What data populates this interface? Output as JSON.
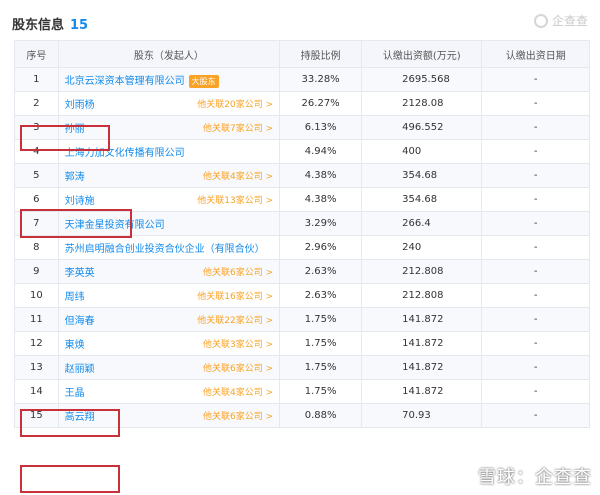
{
  "header": {
    "title": "股东信息",
    "count": "15",
    "logo_text": "企查查"
  },
  "table": {
    "columns": [
      "序号",
      "股东（发起人）",
      "持股比例",
      "认缴出资额(万元)",
      "认缴出资日期"
    ],
    "rows": [
      {
        "idx": "1",
        "name": "北京云深资本管理有限公司",
        "badge": "大股东",
        "rel": "",
        "ratio": "33.28%",
        "amount": "2695.568",
        "date": "-"
      },
      {
        "idx": "2",
        "name": "刘雨杨",
        "badge": "",
        "rel": "他关联20家公司 >",
        "ratio": "26.27%",
        "amount": "2128.08",
        "date": "-"
      },
      {
        "idx": "3",
        "name": "孙丽",
        "badge": "",
        "rel": "他关联7家公司 >",
        "ratio": "6.13%",
        "amount": "496.552",
        "date": "-"
      },
      {
        "idx": "4",
        "name": "上海力加文化传播有限公司",
        "badge": "",
        "rel": "",
        "ratio": "4.94%",
        "amount": "400",
        "date": "-"
      },
      {
        "idx": "5",
        "name": "郭涛",
        "badge": "",
        "rel": "他关联4家公司 >",
        "ratio": "4.38%",
        "amount": "354.68",
        "date": "-"
      },
      {
        "idx": "6",
        "name": "刘诗施",
        "badge": "",
        "rel": "他关联13家公司 >",
        "ratio": "4.38%",
        "amount": "354.68",
        "date": "-"
      },
      {
        "idx": "7",
        "name": "天津金星投资有限公司",
        "badge": "",
        "rel": "",
        "ratio": "3.29%",
        "amount": "266.4",
        "date": "-"
      },
      {
        "idx": "8",
        "name": "苏州启明融合创业投资合伙企业（有限合伙）",
        "badge": "",
        "rel": "",
        "ratio": "2.96%",
        "amount": "240",
        "date": "-"
      },
      {
        "idx": "9",
        "name": "李英英",
        "badge": "",
        "rel": "他关联6家公司 >",
        "ratio": "2.63%",
        "amount": "212.808",
        "date": "-"
      },
      {
        "idx": "10",
        "name": "周纬",
        "badge": "",
        "rel": "他关联16家公司 >",
        "ratio": "2.63%",
        "amount": "212.808",
        "date": "-"
      },
      {
        "idx": "11",
        "name": "但海春",
        "badge": "",
        "rel": "他关联22家公司 >",
        "ratio": "1.75%",
        "amount": "141.872",
        "date": "-"
      },
      {
        "idx": "12",
        "name": "東焕",
        "badge": "",
        "rel": "他关联3家公司 >",
        "ratio": "1.75%",
        "amount": "141.872",
        "date": "-"
      },
      {
        "idx": "13",
        "name": "赵丽颖",
        "badge": "",
        "rel": "他关联6家公司 >",
        "ratio": "1.75%",
        "amount": "141.872",
        "date": "-"
      },
      {
        "idx": "14",
        "name": "王晶",
        "badge": "",
        "rel": "他关联4家公司 >",
        "ratio": "1.75%",
        "amount": "141.872",
        "date": "-"
      },
      {
        "idx": "15",
        "name": "高云翔",
        "badge": "",
        "rel": "他关联6家公司 >",
        "ratio": "0.88%",
        "amount": "70.93",
        "date": "-"
      }
    ]
  },
  "watermark": "雪球：企查查",
  "colors": {
    "link": "#128bed",
    "relation": "#f9a225",
    "highlight": "#c8303a"
  }
}
